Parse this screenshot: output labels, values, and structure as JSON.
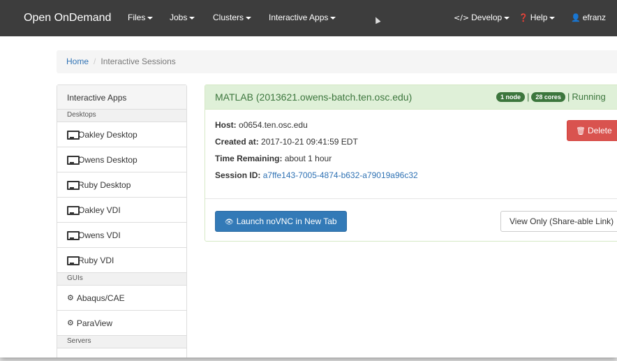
{
  "navbar": {
    "brand": "Open OnDemand",
    "files": "Files",
    "jobs": "Jobs",
    "clusters": "Clusters",
    "interactive_apps": "Interactive Apps",
    "develop": "Develop",
    "help": "Help",
    "user": "efranz",
    "develop_icon": "code-icon",
    "help_icon": "question-circle-icon",
    "user_icon": "user-icon"
  },
  "breadcrumb": {
    "home": "Home",
    "separator": "/",
    "current": "Interactive Sessions"
  },
  "sidebar": {
    "title": "Interactive Apps",
    "categories": {
      "desktops": "Desktops",
      "guis": "GUIs",
      "servers": "Servers"
    },
    "items": [
      {
        "label": "Oakley Desktop",
        "icon": "desktop-icon"
      },
      {
        "label": "Owens Desktop",
        "icon": "desktop-icon"
      },
      {
        "label": "Ruby Desktop",
        "icon": "desktop-icon"
      },
      {
        "label": "Oakley VDI",
        "icon": "desktop-icon"
      },
      {
        "label": "Owens VDI",
        "icon": "desktop-icon"
      },
      {
        "label": "Ruby VDI",
        "icon": "desktop-icon"
      },
      {
        "label": "Abaqus/CAE",
        "icon": "gear-icon"
      },
      {
        "label": "ParaView",
        "icon": "gear-icon"
      }
    ]
  },
  "session": {
    "title": "MATLAB (2013621.owens-batch.ten.osc.edu)",
    "nodes_badge": "1 node",
    "cores_badge": "28 cores",
    "separator": "|",
    "status": "Running",
    "host_label": "Host:",
    "host_value": "o0654.ten.osc.edu",
    "created_label": "Created at:",
    "created_value": "2017-10-21 09:41:59 EDT",
    "time_label": "Time Remaining:",
    "time_value": "about 1 hour",
    "session_id_label": "Session ID:",
    "session_id_value": "a7ffe143-7005-4874-b632-a79019a96c32",
    "delete_label": "Delete",
    "launch_label": "Launch noVNC in New Tab",
    "view_only_label": "View Only (Share-able Link)"
  },
  "colors": {
    "navbar_bg": "#3d3d3d",
    "panel_success_bg": "#dff0d8",
    "success_text": "#3c763d",
    "primary": "#337ab7",
    "danger": "#d9534f",
    "link": "#2f72b4"
  }
}
